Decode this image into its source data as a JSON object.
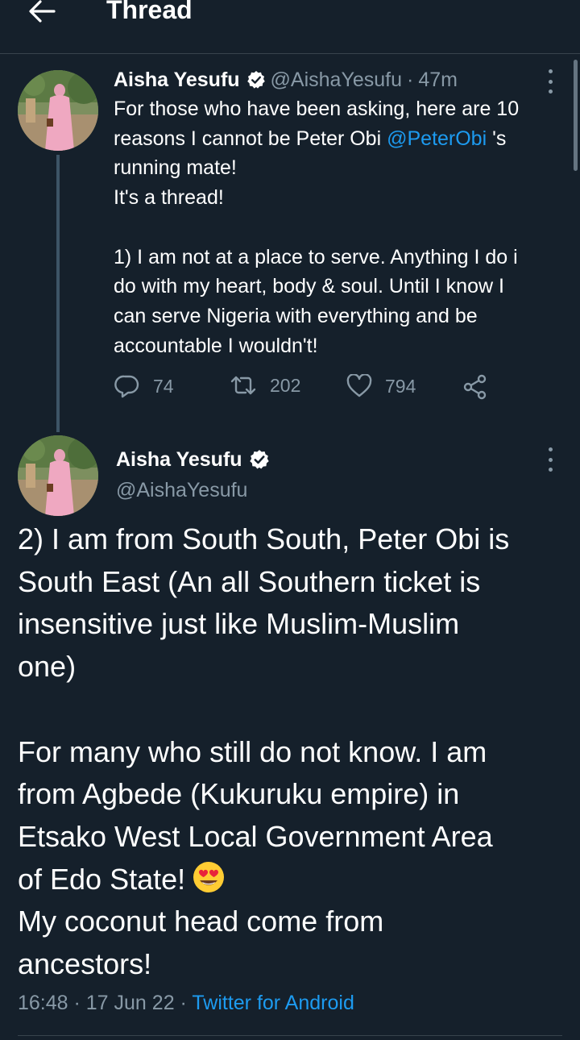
{
  "topbar": {
    "title": "Thread",
    "back_icon": "arrow-left-icon"
  },
  "tweet1": {
    "author_name": "Aisha Yesufu",
    "handle": "@AishaYesufu",
    "separator": "·",
    "time": "47m",
    "lines": [
      "For those who have been asking, here are 10",
      "reasons I cannot be Peter Obi",
      "running mate!",
      "It's a thread!",
      "1) I am not at a place to serve. Anything I do i",
      "do with my heart, body & soul. Until I know I",
      "can serve Nigeria with everything and be",
      "accountable I wouldn't!"
    ],
    "mention": "@PeterObi",
    "mention_suffix": "'s",
    "replies": "74",
    "retweets": "202",
    "likes": "794"
  },
  "tweet2": {
    "author_name": "Aisha Yesufu",
    "handle": "@AishaYesufu",
    "paragraph1": [
      "2) I am from South South, Peter Obi is",
      "South East (An all Southern ticket is",
      "insensitive just like Muslim-Muslim",
      "one)"
    ],
    "paragraph2": [
      "For many who still do not know. I am",
      "from Agbede (Kukuruku empire) in",
      "Etsako West Local Government Area",
      "of Edo State!",
      "My coconut head come from",
      "ancestors!"
    ],
    "emoji": "heart-eyes-emoji",
    "timestamp": "16:48 · 17 Jun 22",
    "dot": "·",
    "source": "Twitter for Android"
  },
  "colors": {
    "background": "#15202b",
    "accent": "#1d9bf0",
    "secondary_text": "#8899a6",
    "divider": "#38444d"
  }
}
